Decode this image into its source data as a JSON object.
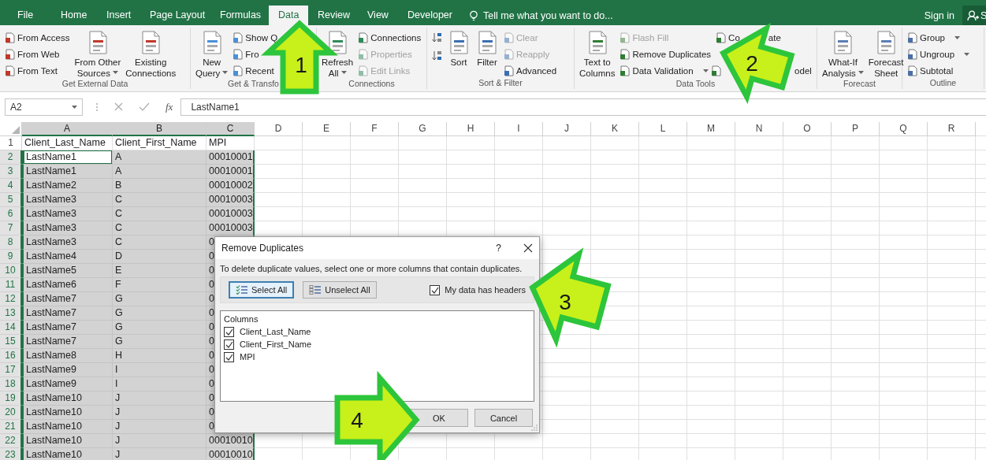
{
  "tabs": [
    {
      "label": "File",
      "selected": false
    },
    {
      "label": "Home",
      "selected": false
    },
    {
      "label": "Insert",
      "selected": false
    },
    {
      "label": "Page Layout",
      "selected": false
    },
    {
      "label": "Formulas",
      "selected": false
    },
    {
      "label": "Data",
      "selected": true
    },
    {
      "label": "Review",
      "selected": false
    },
    {
      "label": "View",
      "selected": false
    },
    {
      "label": "Developer",
      "selected": false
    }
  ],
  "tell_me": "Tell me what you want to do...",
  "account": {
    "sign_in": "Sign in",
    "share": "S"
  },
  "ribbon": {
    "groups": [
      {
        "label": "Get External Data",
        "controls": [
          {
            "kind": "stack",
            "items": [
              {
                "text": "From Access",
                "disabled": false
              },
              {
                "text": "From Web",
                "disabled": false
              },
              {
                "text": "From Text",
                "disabled": false
              }
            ]
          },
          {
            "kind": "large",
            "lines": [
              "From Other",
              "Sources"
            ],
            "dropdown": true
          },
          {
            "kind": "large",
            "lines": [
              "Existing",
              "Connections"
            ],
            "dropdown": false
          }
        ]
      },
      {
        "label": "Get & Transfo",
        "controls": [
          {
            "kind": "large",
            "lines": [
              "New",
              "Query"
            ],
            "dropdown": true
          },
          {
            "kind": "stack",
            "items": [
              {
                "text": "Show Q",
                "disabled": false
              },
              {
                "text": "Fro",
                "disabled": false
              },
              {
                "text": "Recent",
                "disabled": false
              }
            ]
          }
        ]
      },
      {
        "label": "Connections",
        "controls": [
          {
            "kind": "large",
            "lines": [
              "Refresh",
              "All"
            ],
            "dropdown": true
          },
          {
            "kind": "stack",
            "items": [
              {
                "text": "Connections",
                "disabled": false
              },
              {
                "text": "Properties",
                "disabled": true
              },
              {
                "text": "Edit Links",
                "disabled": true
              }
            ]
          }
        ]
      },
      {
        "label": "Sort & Filter",
        "controls": [
          {
            "kind": "sort_pair"
          },
          {
            "kind": "large",
            "lines": [
              "Sort"
            ],
            "dropdown": false
          },
          {
            "kind": "large",
            "lines": [
              "Filter"
            ],
            "dropdown": false
          },
          {
            "kind": "stack",
            "items": [
              {
                "text": "Clear",
                "disabled": true
              },
              {
                "text": "Reapply",
                "disabled": true
              },
              {
                "text": "Advanced",
                "disabled": false
              }
            ]
          }
        ]
      },
      {
        "label": "Data Tools",
        "controls": [
          {
            "kind": "large",
            "lines": [
              "Text to",
              "Columns"
            ],
            "dropdown": false
          },
          {
            "kind": "stack",
            "items": [
              {
                "text": "Flash Fill",
                "disabled": true
              },
              {
                "text": "Remove Duplicates",
                "disabled": false
              },
              {
                "text": "Data Validation",
                "disabled": false,
                "dropdown": true
              }
            ]
          },
          {
            "kind": "stack",
            "items": [
              {
                "text": "Co",
                "tail": "ate",
                "disabled": false
              },
              {
                "tail": "odel",
                "disabled": false
              }
            ]
          }
        ]
      },
      {
        "label": "Forecast",
        "controls": [
          {
            "kind": "large",
            "lines": [
              "What-If",
              "Analysis"
            ],
            "dropdown": true
          },
          {
            "kind": "large",
            "lines": [
              "Forecast",
              "Sheet"
            ],
            "dropdown": false
          }
        ]
      },
      {
        "label": "Outline",
        "controls": [
          {
            "kind": "stack",
            "items": [
              {
                "text": "Group",
                "disabled": false,
                "dropdown": true
              },
              {
                "text": "Ungroup",
                "disabled": false,
                "dropdown": true
              },
              {
                "text": "Subtotal",
                "disabled": false
              }
            ]
          }
        ]
      }
    ]
  },
  "formula_bar": {
    "name_box": "A2",
    "function_label": "fx",
    "value": "LastName1"
  },
  "sheet": {
    "columns": [
      {
        "label": "A",
        "selected": true,
        "active": true
      },
      {
        "label": "B",
        "selected": true,
        "active": false
      },
      {
        "label": "C",
        "selected": true,
        "active": false
      },
      {
        "label": "D",
        "selected": false,
        "active": false
      },
      {
        "label": "E",
        "selected": false,
        "active": false
      },
      {
        "label": "F",
        "selected": false,
        "active": false
      },
      {
        "label": "G",
        "selected": false,
        "active": false
      },
      {
        "label": "H",
        "selected": false,
        "active": false
      },
      {
        "label": "I",
        "selected": false,
        "active": false
      },
      {
        "label": "J",
        "selected": false,
        "active": false
      },
      {
        "label": "K",
        "selected": false,
        "active": false
      },
      {
        "label": "L",
        "selected": false,
        "active": false
      },
      {
        "label": "M",
        "selected": false,
        "active": false
      },
      {
        "label": "N",
        "selected": false,
        "active": false
      },
      {
        "label": "O",
        "selected": false,
        "active": false
      },
      {
        "label": "P",
        "selected": false,
        "active": false
      },
      {
        "label": "Q",
        "selected": false,
        "active": false
      },
      {
        "label": "R",
        "selected": false,
        "active": false
      }
    ],
    "rows": [
      {
        "header": "1",
        "selected": false,
        "active": false,
        "cells": [
          "Client_Last_Name",
          "Client_First_Name",
          "MPI"
        ]
      },
      {
        "header": "2",
        "selected": true,
        "active": true,
        "cells": [
          "LastName1",
          "A",
          "00010001"
        ]
      },
      {
        "header": "3",
        "selected": true,
        "active": false,
        "cells": [
          "LastName1",
          "A",
          "00010001"
        ]
      },
      {
        "header": "4",
        "selected": true,
        "active": false,
        "cells": [
          "LastName2",
          "B",
          "00010002"
        ]
      },
      {
        "header": "5",
        "selected": true,
        "active": false,
        "cells": [
          "LastName3",
          "C",
          "00010003"
        ]
      },
      {
        "header": "6",
        "selected": true,
        "active": false,
        "cells": [
          "LastName3",
          "C",
          "00010003"
        ]
      },
      {
        "header": "7",
        "selected": true,
        "active": false,
        "cells": [
          "LastName3",
          "C",
          "00010003"
        ]
      },
      {
        "header": "8",
        "selected": true,
        "active": false,
        "cells": [
          "LastName3",
          "C",
          "0"
        ]
      },
      {
        "header": "9",
        "selected": true,
        "active": false,
        "cells": [
          "LastName4",
          "D",
          "0"
        ]
      },
      {
        "header": "10",
        "selected": true,
        "active": false,
        "cells": [
          "LastName5",
          "E",
          "0"
        ]
      },
      {
        "header": "11",
        "selected": true,
        "active": false,
        "cells": [
          "LastName6",
          "F",
          "0"
        ]
      },
      {
        "header": "12",
        "selected": true,
        "active": false,
        "cells": [
          "LastName7",
          "G",
          "0"
        ]
      },
      {
        "header": "13",
        "selected": true,
        "active": false,
        "cells": [
          "LastName7",
          "G",
          "0"
        ]
      },
      {
        "header": "14",
        "selected": true,
        "active": false,
        "cells": [
          "LastName7",
          "G",
          "0"
        ]
      },
      {
        "header": "15",
        "selected": true,
        "active": false,
        "cells": [
          "LastName7",
          "G",
          "0"
        ]
      },
      {
        "header": "16",
        "selected": true,
        "active": false,
        "cells": [
          "LastName8",
          "H",
          "0"
        ]
      },
      {
        "header": "17",
        "selected": true,
        "active": false,
        "cells": [
          "LastName9",
          "I",
          "0"
        ]
      },
      {
        "header": "18",
        "selected": true,
        "active": false,
        "cells": [
          "LastName9",
          "I",
          "0"
        ]
      },
      {
        "header": "19",
        "selected": true,
        "active": false,
        "cells": [
          "LastName10",
          "J",
          "0"
        ]
      },
      {
        "header": "20",
        "selected": true,
        "active": false,
        "cells": [
          "LastName10",
          "J",
          "0"
        ]
      },
      {
        "header": "21",
        "selected": true,
        "active": false,
        "cells": [
          "LastName10",
          "J",
          "0"
        ]
      },
      {
        "header": "22",
        "selected": true,
        "active": false,
        "cells": [
          "LastName10",
          "J",
          "00010010"
        ]
      },
      {
        "header": "23",
        "selected": true,
        "active": false,
        "cells": [
          "LastName10",
          "J",
          "00010010"
        ]
      }
    ]
  },
  "dialog": {
    "title": "Remove Duplicates",
    "help": "?",
    "instruction": "To delete duplicate values, select one or more columns that contain duplicates.",
    "buttons": [
      {
        "label": "Select All",
        "focused": true
      },
      {
        "label": "Unselect All",
        "focused": false
      }
    ],
    "headers": {
      "label": "My data has headers",
      "checked": true
    },
    "columns_label": "Columns",
    "columns": [
      {
        "label": "Client_Last_Name",
        "checked": true
      },
      {
        "label": "Client_First_Name",
        "checked": true
      },
      {
        "label": "MPI",
        "checked": true
      }
    ],
    "footer_buttons": [
      {
        "label": "OK",
        "focused": false
      },
      {
        "label": "Cancel",
        "focused": false
      }
    ]
  },
  "annotations": [
    {
      "label": "1"
    },
    {
      "label": "2"
    },
    {
      "label": "3"
    },
    {
      "label": "4"
    }
  ]
}
